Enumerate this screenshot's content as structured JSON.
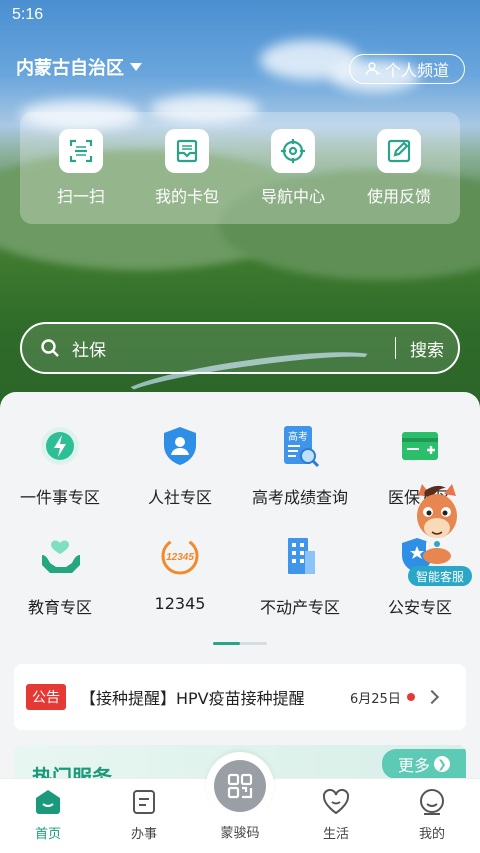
{
  "status_bar": {
    "time": "5:16"
  },
  "header": {
    "region": "内蒙古自治区",
    "personal_channel": "个人频道"
  },
  "quick_actions": [
    {
      "label": "扫一扫",
      "icon": "scan-icon"
    },
    {
      "label": "我的卡包",
      "icon": "card-wallet-icon"
    },
    {
      "label": "导航中心",
      "icon": "navigation-icon"
    },
    {
      "label": "使用反馈",
      "icon": "feedback-icon"
    }
  ],
  "search": {
    "value": "社保",
    "button": "搜索"
  },
  "services": [
    {
      "label": "一件事专区",
      "icon": "one-thing-icon"
    },
    {
      "label": "人社专区",
      "icon": "human-resources-icon"
    },
    {
      "label": "高考成绩查询",
      "icon": "gaokao-query-icon",
      "icon_text": "高考"
    },
    {
      "label": "医保专区",
      "icon": "medical-insurance-icon"
    },
    {
      "label": "教育专区",
      "icon": "education-icon"
    },
    {
      "label": "12345",
      "icon": "hotline-12345-icon",
      "icon_text": "12345"
    },
    {
      "label": "不动产专区",
      "icon": "real-estate-icon"
    },
    {
      "label": "公安专区",
      "icon": "police-icon"
    }
  ],
  "assistant": {
    "label": "智能客服"
  },
  "notice": {
    "tag": "公告",
    "text": "【接种提醒】HPV疫苗接种提醒",
    "date": "6月25日"
  },
  "hot_services": {
    "title": "热门服务",
    "more": "更多"
  },
  "tabbar": {
    "home": "首页",
    "affairs": "办事",
    "code": "蒙骏码",
    "life": "生活",
    "mine": "我的"
  },
  "colors": {
    "accent": "#1a9a7a",
    "notice_red": "#e53935"
  }
}
